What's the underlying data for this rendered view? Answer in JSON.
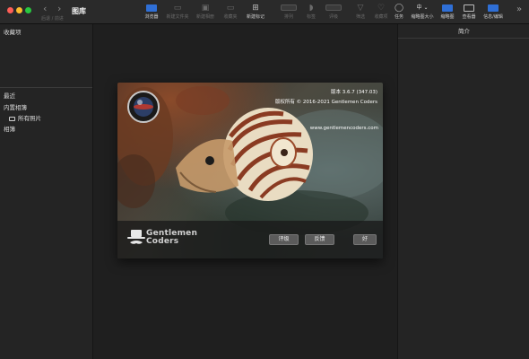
{
  "window": {
    "title": "图库",
    "nav_label": "后退 / 前进"
  },
  "toolbar": {
    "buttons": [
      {
        "label": "浏览器"
      },
      {
        "label": "新建文件夹"
      },
      {
        "label": "新建相册"
      },
      {
        "label": "收藏夹"
      },
      {
        "label": "新建标记"
      },
      {
        "label": "排列"
      },
      {
        "label": "标签"
      },
      {
        "label": "评级"
      },
      {
        "label": "筛选"
      },
      {
        "label": "收藏项"
      },
      {
        "label": "任务"
      },
      {
        "label": "缩略图大小",
        "value": "中"
      },
      {
        "label": "缩略图"
      },
      {
        "label": "查看器"
      },
      {
        "label": "信息/编辑"
      }
    ],
    "overflow": "»"
  },
  "sidebar": {
    "favorites": "收藏项",
    "recent": "最近",
    "builtin": "内置相簿",
    "all_photos": "所有照片",
    "albums": "相簿"
  },
  "inspector": {
    "title": "简介"
  },
  "about": {
    "version": "版本 3.6.7 (347.03)",
    "copyright": "版权所有 © 2016-2021 Gentlemen Coders",
    "website": "www.gentlemencoders.com",
    "logo_line1": "Gentlemen",
    "logo_line2": "Coders",
    "buttons": {
      "rate": "评级",
      "feedback": "反馈",
      "ok": "好"
    }
  }
}
